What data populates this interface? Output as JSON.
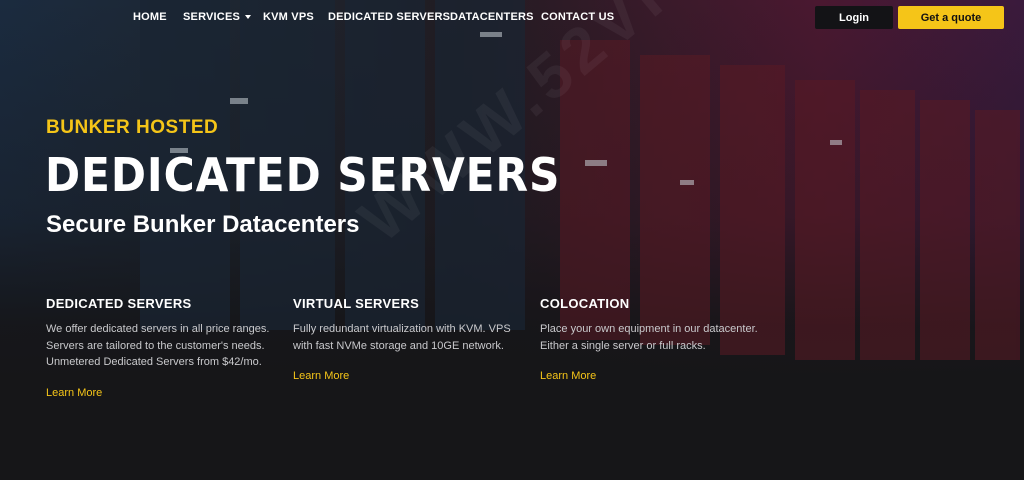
{
  "nav": {
    "links": [
      "HOME",
      "SERVICES",
      "KVM VPS",
      "DEDICATED SERVERS",
      "DATACENTERS",
      "CONTACT US"
    ],
    "login_label": "Login",
    "quote_label": "Get a quote"
  },
  "hero": {
    "eyebrow": "BUNKER HOSTED",
    "title": "DEDICATED SERVERS",
    "subtitle": "Secure Bunker Datacenters"
  },
  "watermark": "WWW.52VPS.COM",
  "features": [
    {
      "title": "DEDICATED SERVERS",
      "text": "We offer dedicated servers in all price ranges. Servers are tailored to the customer's needs. Unmetered Dedicated Servers from $42/mo.",
      "link": "Learn More"
    },
    {
      "title": "VIRTUAL SERVERS",
      "text": "Fully redundant virtualization with KVM. VPS with fast NVMe storage and 10GE network.",
      "link": "Learn More"
    },
    {
      "title": "COLOCATION",
      "text": "Place your own equipment in our datacenter. Either a single server or full racks.",
      "link": "Learn More"
    }
  ],
  "colors": {
    "accent": "#f5c518",
    "background": "#161618"
  }
}
